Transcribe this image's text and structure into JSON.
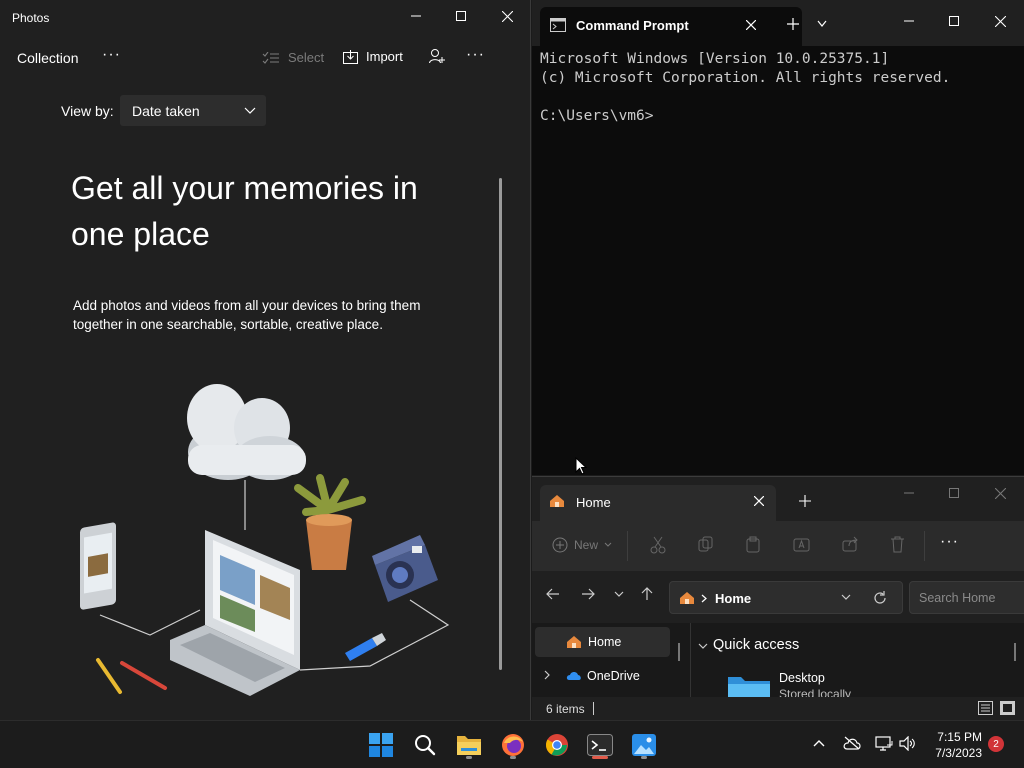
{
  "photos": {
    "title": "Photos",
    "toolbar": {
      "collection": "Collection",
      "more_left": "···",
      "select": "Select",
      "import": "Import",
      "more_right": "···"
    },
    "view_by": {
      "label": "View by:",
      "value": "Date taken"
    },
    "hero": {
      "title_line1": "Get all your memories in",
      "title_line2": "one place",
      "desc_line1": "Add photos and videos from all your devices to bring them",
      "desc_line2": "together in one searchable, sortable, creative place."
    }
  },
  "cmd": {
    "tab_title": "Command Prompt",
    "line1": "Microsoft Windows [Version 10.0.25375.1]",
    "line2": "(c) Microsoft Corporation. All rights reserved.",
    "line3": "",
    "line4": "C:\\Users\\vm6>"
  },
  "explorer": {
    "tab_title": "Home",
    "new_label": "New",
    "more": "···",
    "address": "Home",
    "search_placeholder": "Search Home",
    "nav": {
      "home": "Home",
      "onedrive": "OneDrive"
    },
    "quick_access": "Quick access",
    "item_name": "Desktop",
    "item_sub": "Stored locally",
    "status": "6 items"
  },
  "taskbar": {
    "time": "7:15 PM",
    "date": "7/3/2023",
    "badge": "2"
  },
  "colors": {
    "accent": "#0078d4",
    "folder": "#3fa9e8",
    "badge": "#d13438"
  }
}
